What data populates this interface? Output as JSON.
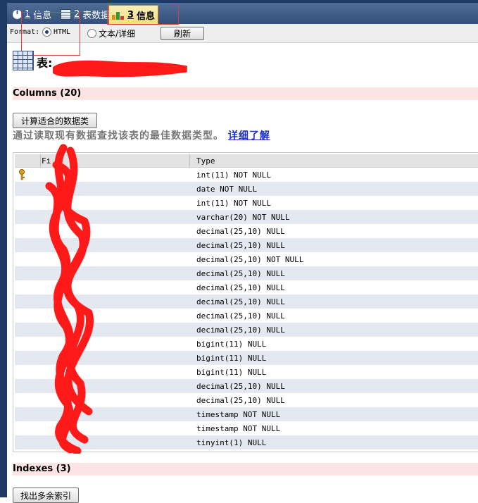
{
  "tabs": [
    {
      "num": "1",
      "label": "信息",
      "icon": "info-icon",
      "active": false
    },
    {
      "num": "2",
      "label": "表数据",
      "icon": "table-icon",
      "active": false
    },
    {
      "num": "3",
      "label": "信息",
      "icon": "chart-icon",
      "active": true
    }
  ],
  "format": {
    "label": "Format:",
    "options": [
      {
        "label": "HTML",
        "selected": true
      },
      {
        "label": "文本/详细",
        "selected": false
      }
    ],
    "refresh_label": "刷新"
  },
  "table": {
    "title": "表:"
  },
  "columns_section": {
    "title": "Columns (20)",
    "calc_button": "计算适合的数据类",
    "hint_text": "通过读取现有数据查找该表的最佳数据类型。",
    "hint_link": "详细了解",
    "grid_headers": [
      "Fi",
      "Type"
    ],
    "rows": [
      {
        "type": "int(11) NOT NULL",
        "primary_key": true
      },
      {
        "type": "date NOT NULL"
      },
      {
        "type": "int(11) NOT NULL"
      },
      {
        "type": "varchar(20) NOT NULL"
      },
      {
        "type": "decimal(25,10) NULL"
      },
      {
        "type": "decimal(25,10) NULL"
      },
      {
        "type": "decimal(25,10) NOT NULL"
      },
      {
        "type": "decimal(25,10) NULL"
      },
      {
        "type": "decimal(25,10) NULL"
      },
      {
        "type": "decimal(25,10) NULL"
      },
      {
        "type": "decimal(25,10) NULL"
      },
      {
        "type": "decimal(25,10) NULL"
      },
      {
        "type": "bigint(11) NULL"
      },
      {
        "type": "bigint(11) NULL"
      },
      {
        "type": "bigint(11) NULL"
      },
      {
        "type": "decimal(25,10) NULL"
      },
      {
        "type": "decimal(25,10) NULL"
      },
      {
        "type": "timestamp NOT NULL"
      },
      {
        "type": "timestamp NOT NULL"
      },
      {
        "type": "tinyint(1) NULL"
      }
    ]
  },
  "indexes_section": {
    "title": "Indexes (3)",
    "button_label": "找出多余索引"
  },
  "colors": {
    "accent_red": "#e03a3a",
    "section_bg": "#fde4e4",
    "tab_active": "#f1df7a",
    "link": "#1a2fcc"
  }
}
